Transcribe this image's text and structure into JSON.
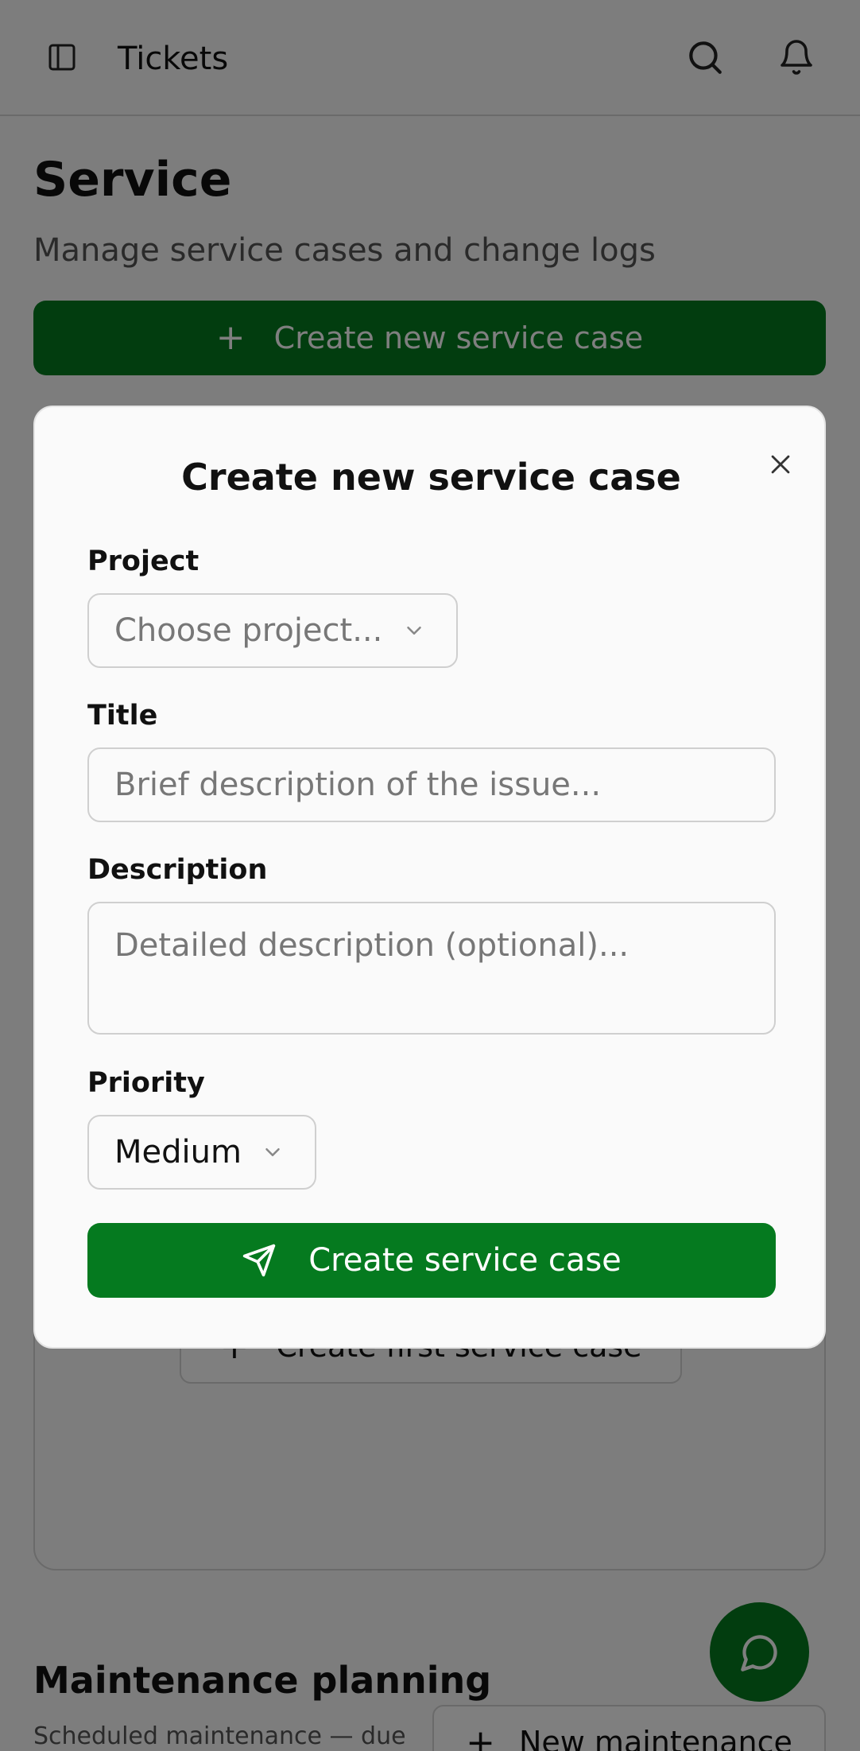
{
  "header": {
    "title": "Tickets",
    "sidebar_toggle_icon": "sidebar-toggle-icon",
    "search_icon": "search-icon",
    "notification_icon": "bell-icon"
  },
  "page": {
    "title": "Service",
    "subtitle": "Manage service cases and change logs",
    "create_button_label": "Create new service case",
    "empty_state_button_label": "Create first service case"
  },
  "maintenance": {
    "title": "Maintenance planning",
    "subtitle": "Scheduled maintenance — due",
    "new_button_label": "New maintenance"
  },
  "modal": {
    "title": "Create new service case",
    "project_label": "Project",
    "project_placeholder": "Choose project...",
    "title_label": "Title",
    "title_placeholder": "Brief description of the issue...",
    "description_label": "Description",
    "description_placeholder": "Detailed description (optional)...",
    "priority_label": "Priority",
    "priority_value": "Medium",
    "submit_label": "Create service case"
  },
  "colors": {
    "primary": "#057a1f",
    "overlay": "rgba(0,0,0,0.5)"
  }
}
